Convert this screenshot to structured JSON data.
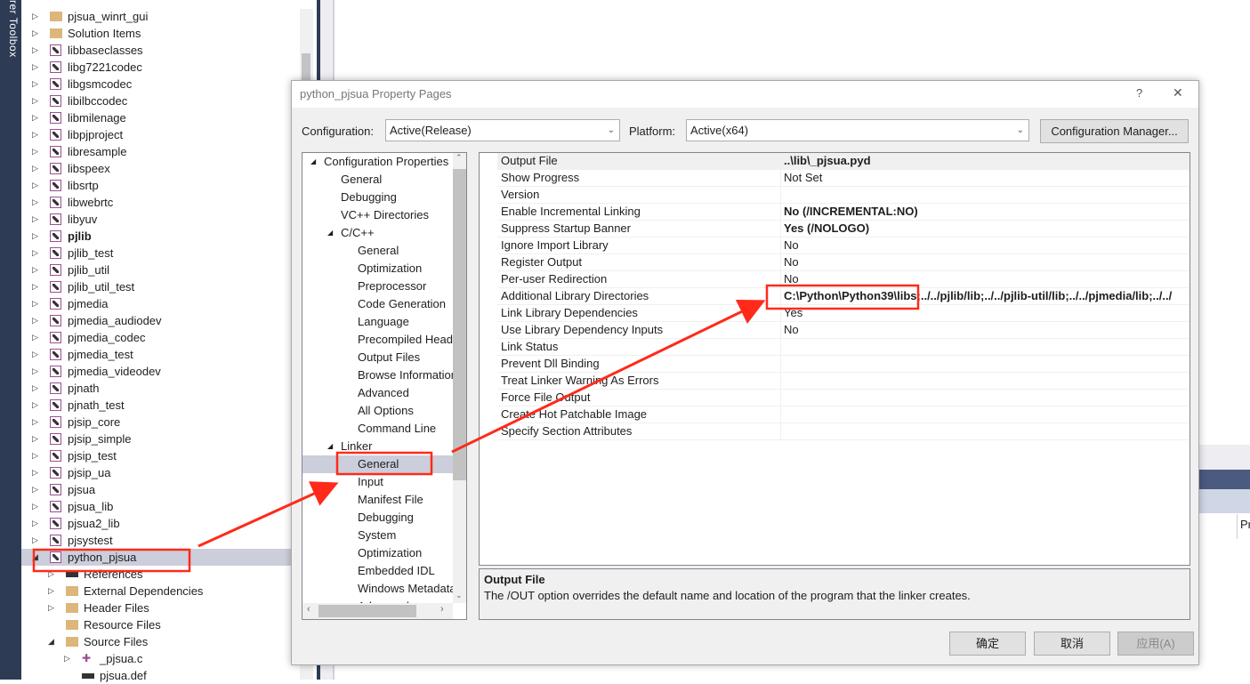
{
  "side_strip": {
    "text": "rer  Toolbox"
  },
  "solution_tree": [
    {
      "label": "pjsua_winrt_gui",
      "type": "folder",
      "exp": "collapsed",
      "indent": 0
    },
    {
      "label": "Solution Items",
      "type": "folder",
      "exp": "collapsed",
      "indent": 0
    },
    {
      "label": "libbaseclasses",
      "type": "project",
      "exp": "collapsed",
      "indent": 0
    },
    {
      "label": "libg7221codec",
      "type": "project",
      "exp": "collapsed",
      "indent": 0
    },
    {
      "label": "libgsmcodec",
      "type": "project",
      "exp": "collapsed",
      "indent": 0
    },
    {
      "label": "libilbccodec",
      "type": "project",
      "exp": "collapsed",
      "indent": 0
    },
    {
      "label": "libmilenage",
      "type": "project",
      "exp": "collapsed",
      "indent": 0
    },
    {
      "label": "libpjproject",
      "type": "project",
      "exp": "collapsed",
      "indent": 0
    },
    {
      "label": "libresample",
      "type": "project",
      "exp": "collapsed",
      "indent": 0
    },
    {
      "label": "libspeex",
      "type": "project",
      "exp": "collapsed",
      "indent": 0
    },
    {
      "label": "libsrtp",
      "type": "project",
      "exp": "collapsed",
      "indent": 0
    },
    {
      "label": "libwebrtc",
      "type": "project",
      "exp": "collapsed",
      "indent": 0
    },
    {
      "label": "libyuv",
      "type": "project",
      "exp": "collapsed",
      "indent": 0
    },
    {
      "label": "pjlib",
      "type": "project",
      "exp": "collapsed",
      "indent": 0,
      "bold": true
    },
    {
      "label": "pjlib_test",
      "type": "project",
      "exp": "collapsed",
      "indent": 0
    },
    {
      "label": "pjlib_util",
      "type": "project",
      "exp": "collapsed",
      "indent": 0
    },
    {
      "label": "pjlib_util_test",
      "type": "project",
      "exp": "collapsed",
      "indent": 0
    },
    {
      "label": "pjmedia",
      "type": "project",
      "exp": "collapsed",
      "indent": 0
    },
    {
      "label": "pjmedia_audiodev",
      "type": "project",
      "exp": "collapsed",
      "indent": 0
    },
    {
      "label": "pjmedia_codec",
      "type": "project",
      "exp": "collapsed",
      "indent": 0
    },
    {
      "label": "pjmedia_test",
      "type": "project",
      "exp": "collapsed",
      "indent": 0
    },
    {
      "label": "pjmedia_videodev",
      "type": "project",
      "exp": "collapsed",
      "indent": 0
    },
    {
      "label": "pjnath",
      "type": "project",
      "exp": "collapsed",
      "indent": 0
    },
    {
      "label": "pjnath_test",
      "type": "project",
      "exp": "collapsed",
      "indent": 0
    },
    {
      "label": "pjsip_core",
      "type": "project",
      "exp": "collapsed",
      "indent": 0
    },
    {
      "label": "pjsip_simple",
      "type": "project",
      "exp": "collapsed",
      "indent": 0
    },
    {
      "label": "pjsip_test",
      "type": "project",
      "exp": "collapsed",
      "indent": 0
    },
    {
      "label": "pjsip_ua",
      "type": "project",
      "exp": "collapsed",
      "indent": 0
    },
    {
      "label": "pjsua",
      "type": "project",
      "exp": "collapsed",
      "indent": 0
    },
    {
      "label": "pjsua_lib",
      "type": "project",
      "exp": "collapsed",
      "indent": 0
    },
    {
      "label": "pjsua2_lib",
      "type": "project",
      "exp": "collapsed",
      "indent": 0
    },
    {
      "label": "pjsystest",
      "type": "project",
      "exp": "collapsed",
      "indent": 0
    },
    {
      "label": "python_pjsua",
      "type": "project",
      "exp": "expanded",
      "indent": 0,
      "selected": true
    },
    {
      "label": "References",
      "type": "ref",
      "exp": "collapsed",
      "indent": 1
    },
    {
      "label": "External Dependencies",
      "type": "folder",
      "exp": "collapsed",
      "indent": 1
    },
    {
      "label": "Header Files",
      "type": "folder",
      "exp": "collapsed",
      "indent": 1
    },
    {
      "label": "Resource Files",
      "type": "folder",
      "exp": "none",
      "indent": 1
    },
    {
      "label": "Source Files",
      "type": "folder",
      "exp": "expanded",
      "indent": 1
    },
    {
      "label": "_pjsua.c",
      "type": "cfile",
      "exp": "collapsed",
      "indent": 2
    },
    {
      "label": "pjsua.def",
      "type": "def",
      "exp": "none",
      "indent": 2
    }
  ],
  "right_panel": {
    "column_fragment": "Pr"
  },
  "dialog": {
    "title": "python_pjsua Property Pages",
    "help": "?",
    "close": "✕",
    "configuration_label": "Configuration:",
    "configuration_value": "Active(Release)",
    "platform_label": "Platform:",
    "platform_value": "Active(x64)",
    "config_manager": "Configuration Manager...",
    "tree": [
      {
        "label": "Configuration Properties",
        "level": 0,
        "exp": "▲"
      },
      {
        "label": "General",
        "level": 1
      },
      {
        "label": "Debugging",
        "level": 1
      },
      {
        "label": "VC++ Directories",
        "level": 1
      },
      {
        "label": "C/C++",
        "level": 1,
        "exp": "▲"
      },
      {
        "label": "General",
        "level": 2
      },
      {
        "label": "Optimization",
        "level": 2
      },
      {
        "label": "Preprocessor",
        "level": 2
      },
      {
        "label": "Code Generation",
        "level": 2
      },
      {
        "label": "Language",
        "level": 2
      },
      {
        "label": "Precompiled Headers",
        "level": 2
      },
      {
        "label": "Output Files",
        "level": 2
      },
      {
        "label": "Browse Information",
        "level": 2
      },
      {
        "label": "Advanced",
        "level": 2
      },
      {
        "label": "All Options",
        "level": 2
      },
      {
        "label": "Command Line",
        "level": 2
      },
      {
        "label": "Linker",
        "level": 1,
        "exp": "▲"
      },
      {
        "label": "General",
        "level": 2,
        "selected": true
      },
      {
        "label": "Input",
        "level": 2
      },
      {
        "label": "Manifest File",
        "level": 2
      },
      {
        "label": "Debugging",
        "level": 2
      },
      {
        "label": "System",
        "level": 2
      },
      {
        "label": "Optimization",
        "level": 2
      },
      {
        "label": "Embedded IDL",
        "level": 2
      },
      {
        "label": "Windows Metadata",
        "level": 2
      },
      {
        "label": "Advanced",
        "level": 2
      }
    ],
    "properties": [
      {
        "name": "Output File",
        "value": "..\\lib\\_pjsua.pyd",
        "bold": true
      },
      {
        "name": "Show Progress",
        "value": "Not Set"
      },
      {
        "name": "Version",
        "value": ""
      },
      {
        "name": "Enable Incremental Linking",
        "value": "No (/INCREMENTAL:NO)",
        "bold": true
      },
      {
        "name": "Suppress Startup Banner",
        "value": "Yes (/NOLOGO)",
        "bold": true
      },
      {
        "name": "Ignore Import Library",
        "value": "No"
      },
      {
        "name": "Register Output",
        "value": "No"
      },
      {
        "name": "Per-user Redirection",
        "value": "No"
      },
      {
        "name": "Additional Library Directories",
        "value": "C:\\Python\\Python39\\libs;../../pjlib/lib;../../pjlib-util/lib;../../pjmedia/lib;../../",
        "bold": true
      },
      {
        "name": "Link Library Dependencies",
        "value": "Yes"
      },
      {
        "name": "Use Library Dependency Inputs",
        "value": "No"
      },
      {
        "name": "Link Status",
        "value": ""
      },
      {
        "name": "Prevent Dll Binding",
        "value": ""
      },
      {
        "name": "Treat Linker Warning As Errors",
        "value": ""
      },
      {
        "name": "Force File Output",
        "value": ""
      },
      {
        "name": "Create Hot Patchable Image",
        "value": ""
      },
      {
        "name": "Specify Section Attributes",
        "value": ""
      }
    ],
    "description": {
      "title": "Output File",
      "text": "The /OUT option overrides the default name and location of the program that the linker creates."
    },
    "ok": "确定",
    "cancel": "取消",
    "apply": "应用(A)"
  },
  "colors": {
    "annotation": "#ff2a1a",
    "selection": "#cccedb",
    "ide_dark": "#2d3b55"
  }
}
